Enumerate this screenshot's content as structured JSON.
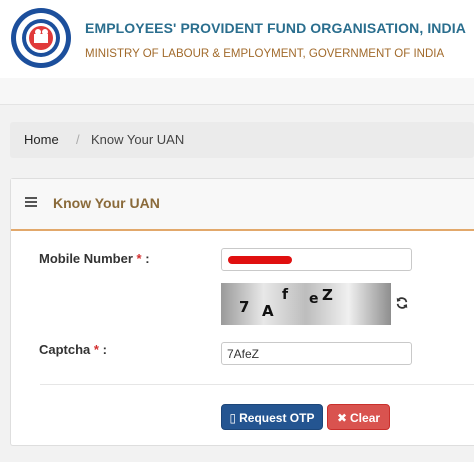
{
  "header": {
    "org_name": "EMPLOYEES' PROVIDENT FUND ORGANISATION, INDIA",
    "ministry": "MINISTRY OF LABOUR & EMPLOYMENT, GOVERNMENT OF INDIA",
    "logo_icon": "epfo-logo-icon"
  },
  "breadcrumb": {
    "home": "Home",
    "separator": "/",
    "current": "Know Your UAN"
  },
  "panel": {
    "title": "Know Your UAN",
    "menu_icon": "hamburger-menu-icon"
  },
  "form": {
    "mobile_label": "Mobile Number",
    "mobile_required": "*",
    "mobile_colon": ":",
    "mobile_value": "",
    "captcha_chars": [
      "7",
      "A",
      "f",
      "e",
      "Z"
    ],
    "refresh_icon": "refresh-icon",
    "captcha_label": "Captcha",
    "captcha_required": "*",
    "captcha_colon": ":",
    "captcha_value": "7AfeZ"
  },
  "buttons": {
    "request_otp_icon": "mobile-icon",
    "request_otp": "Request OTP",
    "clear_icon": "x-icon",
    "clear": "Clear"
  },
  "colors": {
    "org_name": "#2a6e8e",
    "ministry": "#a16a2b",
    "request_otp_bg": "#245591",
    "clear_bg": "#d9534f",
    "required_star": "#d32f2f",
    "redaction": "#e01010"
  }
}
